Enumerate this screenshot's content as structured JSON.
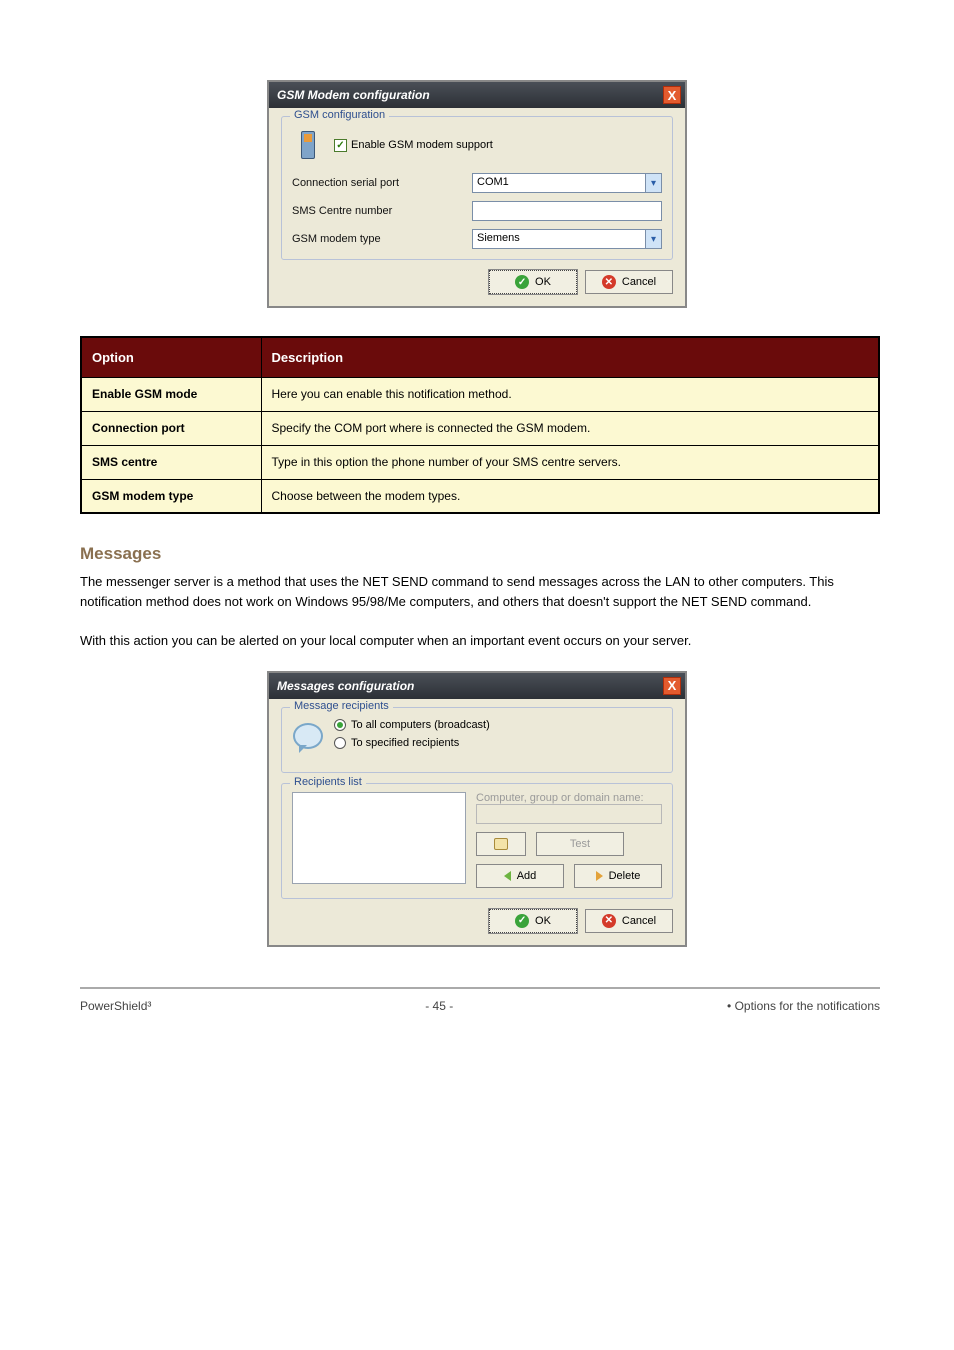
{
  "gsm_dialog": {
    "title": "GSM Modem configuration",
    "close": "X",
    "fieldset_legend": "GSM configuration",
    "enable_label": "Enable GSM modem support",
    "conn_port_label": "Connection serial port",
    "conn_port_value": "COM1",
    "sms_centre_label": "SMS Centre number",
    "sms_centre_value": "",
    "modem_type_label": "GSM modem type",
    "modem_type_value": "Siemens",
    "ok": "OK",
    "cancel": "Cancel"
  },
  "options_table": {
    "head_option": "Option",
    "head_desc": "Description",
    "rows": [
      {
        "k": "Enable GSM mode",
        "v": "Here you can enable this notification method."
      },
      {
        "k": "Connection port",
        "v": "Specify the COM port where is connected the GSM modem."
      },
      {
        "k": "SMS centre",
        "v": "Type in this option the phone number of your SMS centre servers."
      },
      {
        "k": "GSM modem type",
        "v": "Choose between the modem types."
      }
    ]
  },
  "messages_section": {
    "heading": "Messages",
    "para1": "The messenger server is a method that uses the NET SEND command to send messages across the LAN to other computers. This notification method does not work on Windows 95/98/Me computers, and others that doesn't support the NET SEND command.",
    "para2": "With this action you can be alerted on your local computer when an important event occurs on your server."
  },
  "msg_dialog": {
    "title": "Messages configuration",
    "close": "X",
    "recipients_legend": "Message recipients",
    "radio_all": "To all computers (broadcast)",
    "radio_specified": "To specified recipients",
    "list_legend": "Recipients list",
    "name_label": "Computer, group or domain name:",
    "test": "Test",
    "add": "Add",
    "delete": "Delete",
    "ok": "OK",
    "cancel": "Cancel"
  },
  "footer": {
    "left": "PowerShield³",
    "center": "- 45 -",
    "right": "•  Options for the notifications"
  }
}
